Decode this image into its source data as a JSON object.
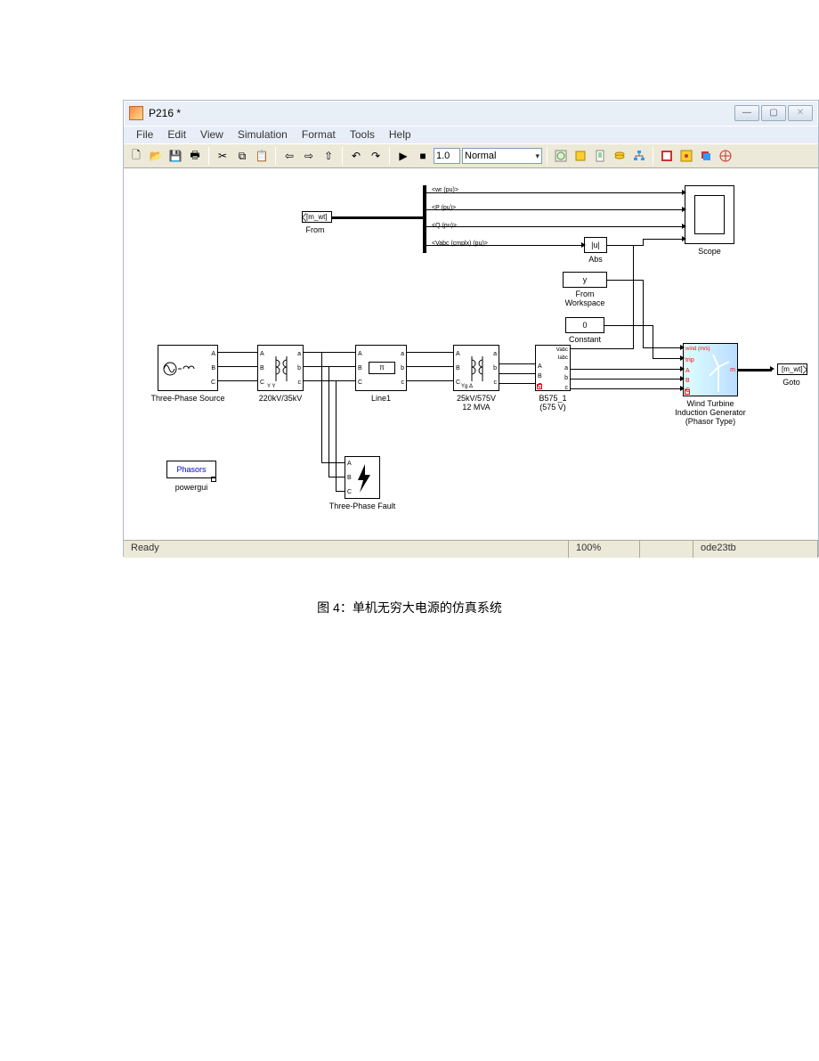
{
  "window": {
    "title": "P216 *",
    "menus": [
      "File",
      "Edit",
      "View",
      "Simulation",
      "Format",
      "Tools",
      "Help"
    ],
    "stop_time": "1.0",
    "sim_mode": "Normal",
    "status": "Ready",
    "zoom": "100%",
    "solver": "ode23tb"
  },
  "blocks": {
    "from": {
      "tag": "[m_wt]",
      "label": "From"
    },
    "goto": {
      "tag": "[m_wt]",
      "label": "Goto"
    },
    "source": {
      "label": "Three-Phase Source",
      "ports": [
        "A",
        "B",
        "C"
      ]
    },
    "xfmr1": {
      "label": "220kV/35kV",
      "lports": [
        "A",
        "B",
        "C"
      ],
      "rports": [
        "a",
        "b",
        "c"
      ],
      "mid": "Y Y"
    },
    "line1": {
      "label": "Line1",
      "lports": [
        "A",
        "B",
        "C"
      ],
      "rports": [
        "a",
        "b",
        "c"
      ],
      "icon": "π"
    },
    "xfmr2": {
      "label": "25kV/575V",
      "label2": "12 MVA",
      "lports": [
        "A",
        "B",
        "C"
      ],
      "rports": [
        "a",
        "b",
        "c"
      ],
      "mid": "Yg Δ"
    },
    "meas": {
      "label": "B575_1",
      "label2": "(575 V)",
      "top": [
        "Vabc",
        "Iabc"
      ],
      "lports": [
        "A",
        "B",
        "C"
      ],
      "rports": [
        "a",
        "b",
        "c"
      ]
    },
    "fault": {
      "label": "Three-Phase Fault",
      "ports": [
        "A",
        "B",
        "C"
      ]
    },
    "powergui": {
      "label": "powergui",
      "text": "Phasors"
    },
    "abs": {
      "label": "Abs",
      "text": "|u|"
    },
    "fromws": {
      "label": "From",
      "label2": "Workspace",
      "text": "y"
    },
    "const": {
      "label": "Constant",
      "text": "0"
    },
    "scope": {
      "label": "Scope"
    },
    "wt": {
      "label": "Wind Turbine",
      "label2": "Induction Generator",
      "label3": "(Phasor Type)",
      "inputs": [
        "wind (m/s)",
        "trip",
        "A",
        "B",
        "C"
      ],
      "out": "m"
    },
    "demux": {
      "sigs": [
        "<wr (pu)>",
        "<P (pu)>",
        "<Q (pu)>",
        "<Vabc (cmplx) (pu)>"
      ]
    }
  },
  "caption": "图 4：单机无穷大电源的仿真系统"
}
